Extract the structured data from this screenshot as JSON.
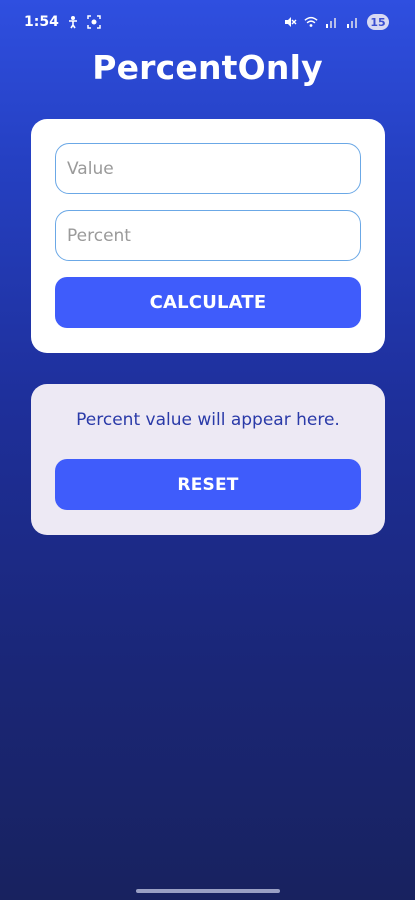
{
  "status_bar": {
    "time": "1:54",
    "battery": "15",
    "icons": [
      "accessibility-icon",
      "screen-record-icon",
      "mute-icon",
      "wifi-icon",
      "signal-icon"
    ]
  },
  "app": {
    "title": "PercentOnly"
  },
  "form": {
    "value_placeholder": "Value",
    "percent_placeholder": "Percent",
    "calculate_label": "CALCULATE"
  },
  "result": {
    "text": "Percent value will appear here.",
    "reset_label": "RESET"
  },
  "colors": {
    "accent": "#3f5cfb",
    "result_text": "#2a3aa8",
    "field_border": "#6ba8e6",
    "result_card_bg": "#ede9f4"
  }
}
